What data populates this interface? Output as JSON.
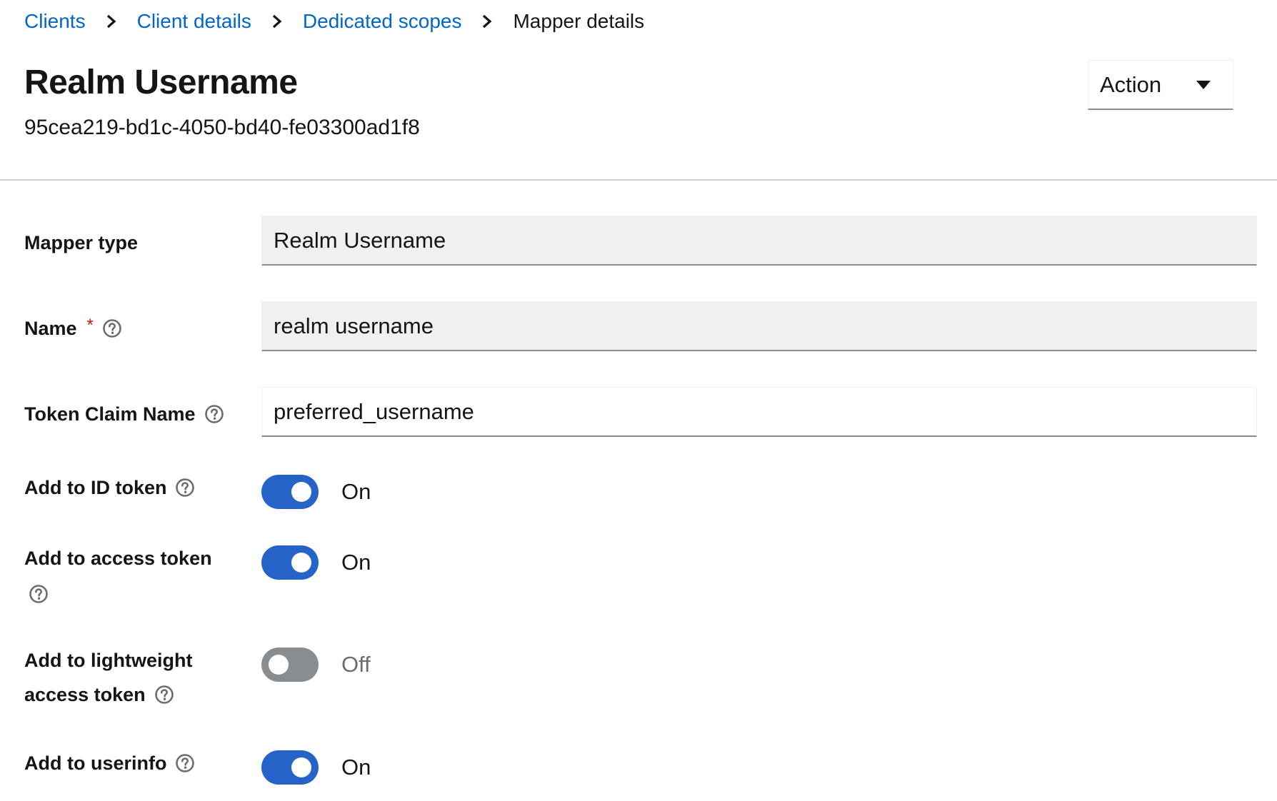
{
  "breadcrumb": {
    "items": [
      "Clients",
      "Client details",
      "Dedicated scopes"
    ],
    "current": "Mapper details"
  },
  "header": {
    "title": "Realm Username",
    "subtitle": "95cea219-bd1c-4050-bd40-fe03300ad1f8",
    "action_label": "Action"
  },
  "form": {
    "mapper_type": {
      "label": "Mapper type",
      "value": "Realm Username"
    },
    "name": {
      "label": "Name",
      "required_mark": "*",
      "value": "realm username"
    },
    "token_claim_name": {
      "label": "Token Claim Name",
      "value": "preferred_username"
    },
    "add_to_id_token": {
      "label": "Add to ID token",
      "state": "On",
      "enabled": true
    },
    "add_to_access_token": {
      "label": "Add to access token",
      "state": "On",
      "enabled": true
    },
    "add_to_lightweight_access_token": {
      "label_line1": "Add to lightweight",
      "label_line2": "access token",
      "state": "Off",
      "enabled": false
    },
    "add_to_userinfo": {
      "label": "Add to userinfo",
      "state": "On",
      "enabled": true
    }
  },
  "colors": {
    "link": "#0066cc",
    "switch_on": "#2563c9",
    "switch_off": "#8a8d90",
    "required": "#c9190b"
  },
  "icons": {
    "breadcrumb_separator": "chevron-right-icon",
    "action_dropdown": "caret-down-icon",
    "help": "question-circle-icon"
  }
}
